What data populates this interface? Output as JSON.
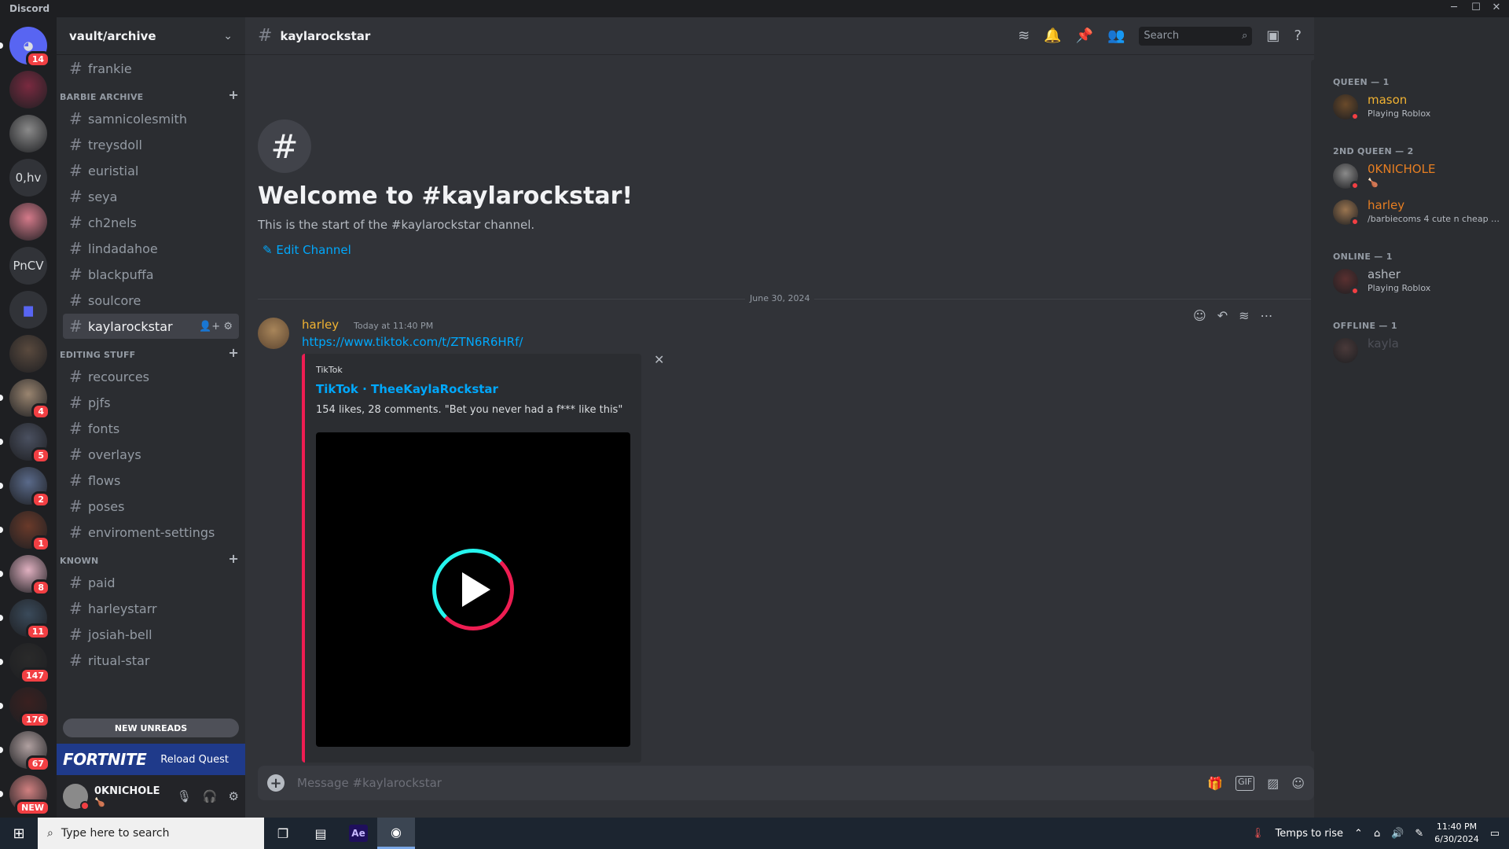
{
  "window": {
    "app_name": "Discord",
    "minimize": "─",
    "maximize": "☐",
    "close": "✕"
  },
  "guilds": [
    {
      "kind": "home",
      "badge": "14"
    },
    {
      "kind": "avatar",
      "color": "#7a2a40",
      "badge": ""
    },
    {
      "kind": "avatar",
      "color": "#8a8a8a",
      "badge": ""
    },
    {
      "kind": "text",
      "label": "0,hv",
      "badge": ""
    },
    {
      "kind": "avatar",
      "color": "#d47a8a",
      "badge": ""
    },
    {
      "kind": "text",
      "label": "PnCV",
      "badge": ""
    },
    {
      "kind": "folder",
      "badge": ""
    },
    {
      "kind": "avatar",
      "color": "#5a4a3e",
      "badge": ""
    },
    {
      "kind": "avatar",
      "color": "#9a8570",
      "badge": "4"
    },
    {
      "kind": "avatar",
      "color": "#4a5060",
      "badge": "5"
    },
    {
      "kind": "avatar",
      "color": "#5a6a8a",
      "badge": "2"
    },
    {
      "kind": "avatar",
      "color": "#6a3a2a",
      "badge": "1"
    },
    {
      "kind": "avatar",
      "color": "#e0b0c0",
      "badge": "8"
    },
    {
      "kind": "avatar",
      "color": "#3a4a5a",
      "badge": "11"
    },
    {
      "kind": "avatar",
      "color": "#2a2a2a",
      "badge": "147"
    },
    {
      "kind": "avatar",
      "color": "#3a2020",
      "badge": "176"
    },
    {
      "kind": "avatar",
      "color": "#b0a0a0",
      "badge": "67"
    },
    {
      "kind": "avatar",
      "color": "#d08080",
      "badge": "NEW"
    }
  ],
  "server": {
    "name": "vault/archive"
  },
  "channels_top": [
    {
      "name": "frankie"
    }
  ],
  "categories": [
    {
      "name": "BARBIE ARCHIVE",
      "channels": [
        "samnicolesmith",
        "treysdoll",
        "euristial",
        "seya",
        "ch2nels",
        "lindadahoe",
        "blackpuffa",
        "soulcore",
        "kaylarockstar"
      ]
    },
    {
      "name": "EDITING STUFF",
      "channels": [
        "recources",
        "pjfs",
        "fonts",
        "overlays",
        "flows",
        "poses",
        "enviroment-settings"
      ]
    },
    {
      "name": "KNOWN",
      "channels": [
        "paid",
        "harleystarr",
        "josiah-bell",
        "ritual-star"
      ]
    }
  ],
  "active_channel": "kaylarockstar",
  "new_unreads": "NEW UNREADS",
  "quest": {
    "game": "FORTNITE",
    "label": "Reload Quest"
  },
  "user": {
    "name": "0KNICHOLE",
    "status_emoji": "🍗"
  },
  "header": {
    "channel": "kaylarockstar",
    "search_placeholder": "Search"
  },
  "welcome": {
    "title": "Welcome to #kaylarockstar!",
    "subtitle": "This is the start of the #kaylarockstar channel.",
    "edit": "Edit Channel"
  },
  "date_divider": "June 30, 2024",
  "message": {
    "author": "harley",
    "timestamp": "Today at 11:40 PM",
    "link": "https://www.tiktok.com/t/ZTN6R6HRf/",
    "embed": {
      "provider": "TikTok",
      "title": "TikTok · TheeKaylaRockstar",
      "description": "154 likes, 28 comments. \"Bet you never had a f*** like this\""
    }
  },
  "composer": {
    "placeholder": "Message #kaylarockstar"
  },
  "members": {
    "groups": [
      {
        "label": "QUEEN — 1",
        "members": [
          {
            "name": "mason",
            "status": "Playing Roblox",
            "color": "#f0b232",
            "avatar": "#6a4a2a"
          }
        ]
      },
      {
        "label": "2ND QUEEN — 2",
        "members": [
          {
            "name": "0KNICHOLE",
            "status": "🍗",
            "color": "#e67e22",
            "avatar": "#8a8a8a"
          },
          {
            "name": "harley",
            "status": "/barbiecoms 4 cute n cheap e...",
            "color": "#e67e22",
            "avatar": "#9a7550"
          }
        ]
      },
      {
        "label": "ONLINE — 1",
        "members": [
          {
            "name": "asher",
            "status": "Playing Roblox",
            "color": "#b5bac1",
            "avatar": "#5a3030"
          }
        ]
      },
      {
        "label": "OFFLINE — 1",
        "members": [
          {
            "name": "kayla",
            "status": "",
            "color": "#4e5058",
            "avatar": "#4a3a3a"
          }
        ]
      }
    ]
  },
  "taskbar": {
    "search_placeholder": "Type here to search",
    "weather": "Temps to rise",
    "time": "11:40 PM",
    "date": "6/30/2024",
    "ae_label": "Ae"
  }
}
